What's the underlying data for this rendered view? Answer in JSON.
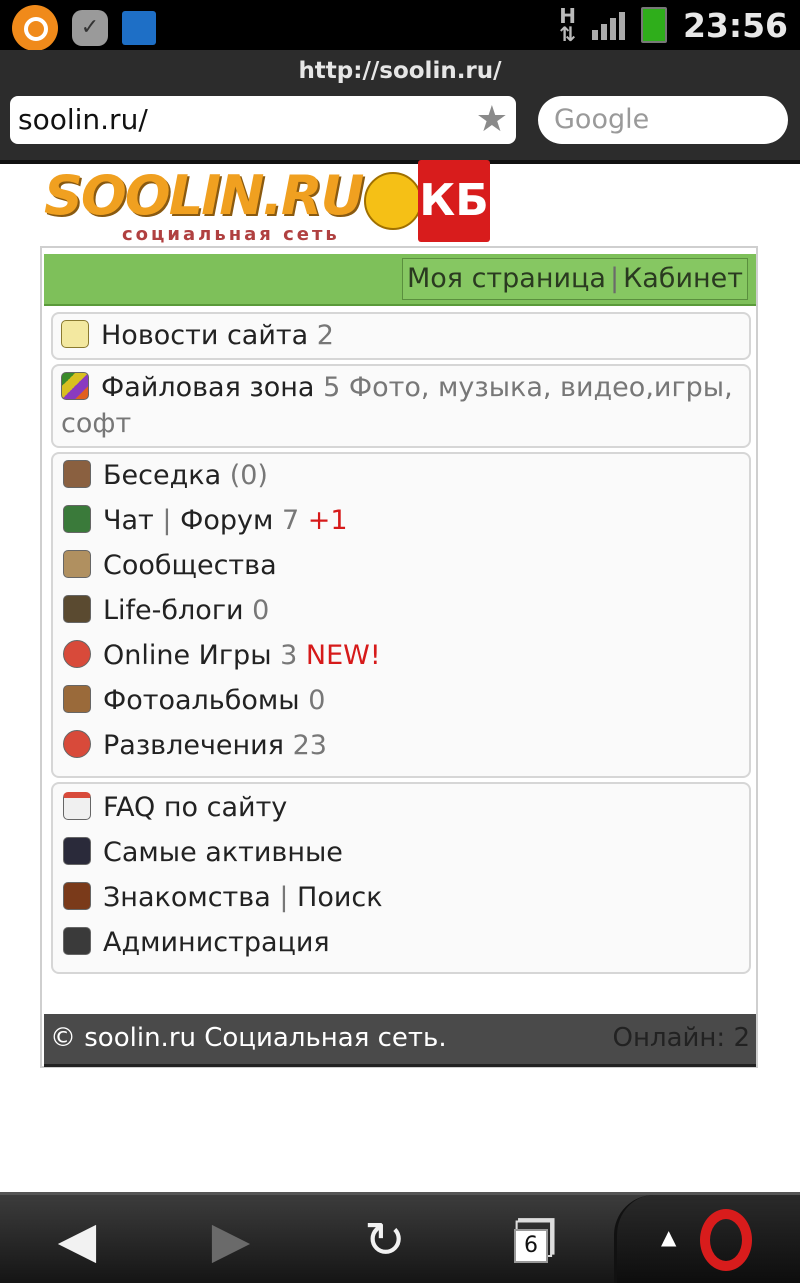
{
  "status_bar": {
    "time": "23:56",
    "network": "H",
    "icons": [
      "opera-mini-icon",
      "check-icon",
      "wifi-icon",
      "signal-icon",
      "battery-icon"
    ]
  },
  "browser": {
    "page_url": "http://soolin.ru/",
    "address_value": "soolin.ru/",
    "search_placeholder": "Google"
  },
  "logo": {
    "wordmark": "SOOLIN.RU",
    "tagline": "социальная сеть",
    "badge": "КБ"
  },
  "header_links": {
    "my_page": "Моя страница",
    "separator": "|",
    "cabinet": "Кабинет"
  },
  "blocks": {
    "news": {
      "label": "Новости сайта",
      "count": "2"
    },
    "files": {
      "label": "Файловая зона",
      "count": "5",
      "desc_line1": "Фото, музыка, видео,игры,",
      "desc_line2": "софт"
    },
    "community": [
      {
        "label": "Беседка",
        "count": "(0)"
      },
      {
        "label": "Чат",
        "sep": "|",
        "label2": "Форум",
        "count": "7",
        "extra": "+1"
      },
      {
        "label": "Сообщества"
      },
      {
        "label": "Life-блоги",
        "count": "0"
      },
      {
        "label": "Online Игры",
        "count": "3",
        "extra": "NEW!"
      },
      {
        "label": "Фотоальбомы",
        "count": "0"
      },
      {
        "label": "Развлечения",
        "count": "23"
      }
    ],
    "info": [
      {
        "label": "FAQ по сайту"
      },
      {
        "label": "Самые активные"
      },
      {
        "label": "Знакомства",
        "sep": "|",
        "label2": "Поиск"
      },
      {
        "label": "Администрация"
      }
    ]
  },
  "footer": {
    "copyright": "© soolin.ru Социальная сеть.",
    "online": "Онлайн: 2"
  },
  "bottom_nav": {
    "tabs_count": "6"
  },
  "colors": {
    "header_green": "#7ec05a",
    "footer_gray": "#4a4a4a",
    "accent_red": "#d61a1a"
  }
}
